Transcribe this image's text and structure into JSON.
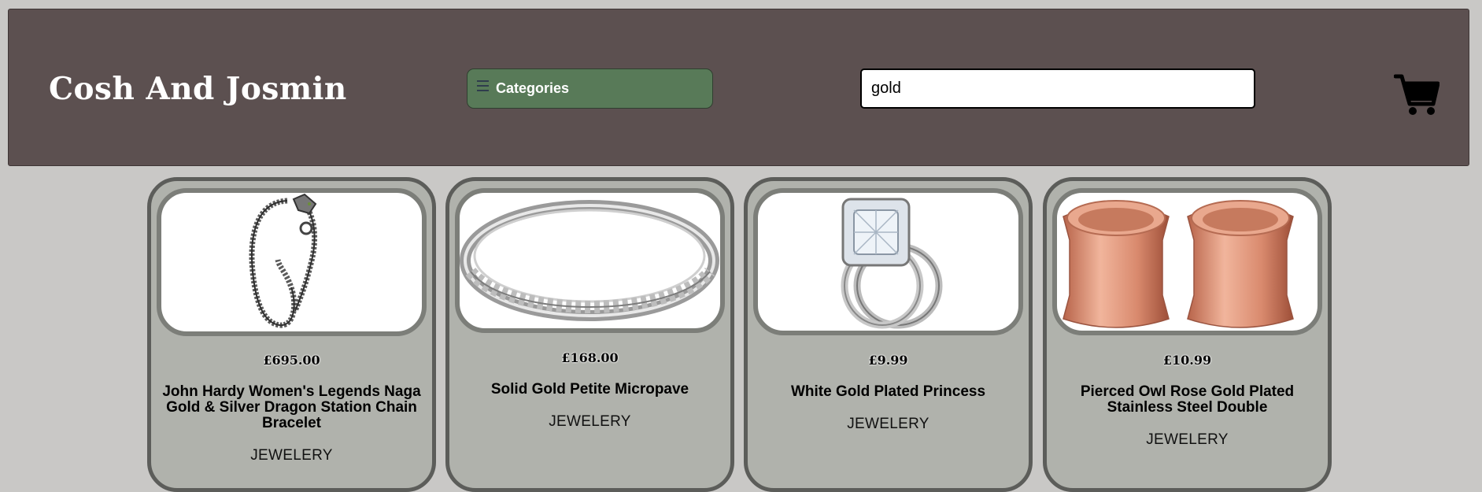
{
  "header": {
    "brand": "Cosh And Josmin",
    "categories_label": "Categories",
    "search_value": "gold",
    "menu_icon": "hamburger-icon",
    "cart_icon": "shopping-cart-icon"
  },
  "colors": {
    "page_background": "#c9c8c6",
    "header_background": "#5c5050",
    "categories_button": "#587a58",
    "card_background": "#b0b2ac",
    "card_border": "#5c5d5a"
  },
  "products": [
    {
      "price": "£695.00",
      "title": "John Hardy Women's Legends Naga Gold & Silver Dragon Station Chain Bracelet",
      "category": "JEWELERY",
      "image_icon": "dragon-bracelet-image"
    },
    {
      "price": "£168.00",
      "title": "Solid Gold Petite Micropave",
      "category": "JEWELERY",
      "image_icon": "silver-band-ring-image"
    },
    {
      "price": "£9.99",
      "title": "White Gold Plated Princess",
      "category": "JEWELERY",
      "image_icon": "diamond-engagement-ring-image"
    },
    {
      "price": "£10.99",
      "title": "Pierced Owl Rose Gold Plated Stainless Steel Double",
      "category": "JEWELERY",
      "image_icon": "rose-gold-tunnel-plugs-image"
    }
  ]
}
